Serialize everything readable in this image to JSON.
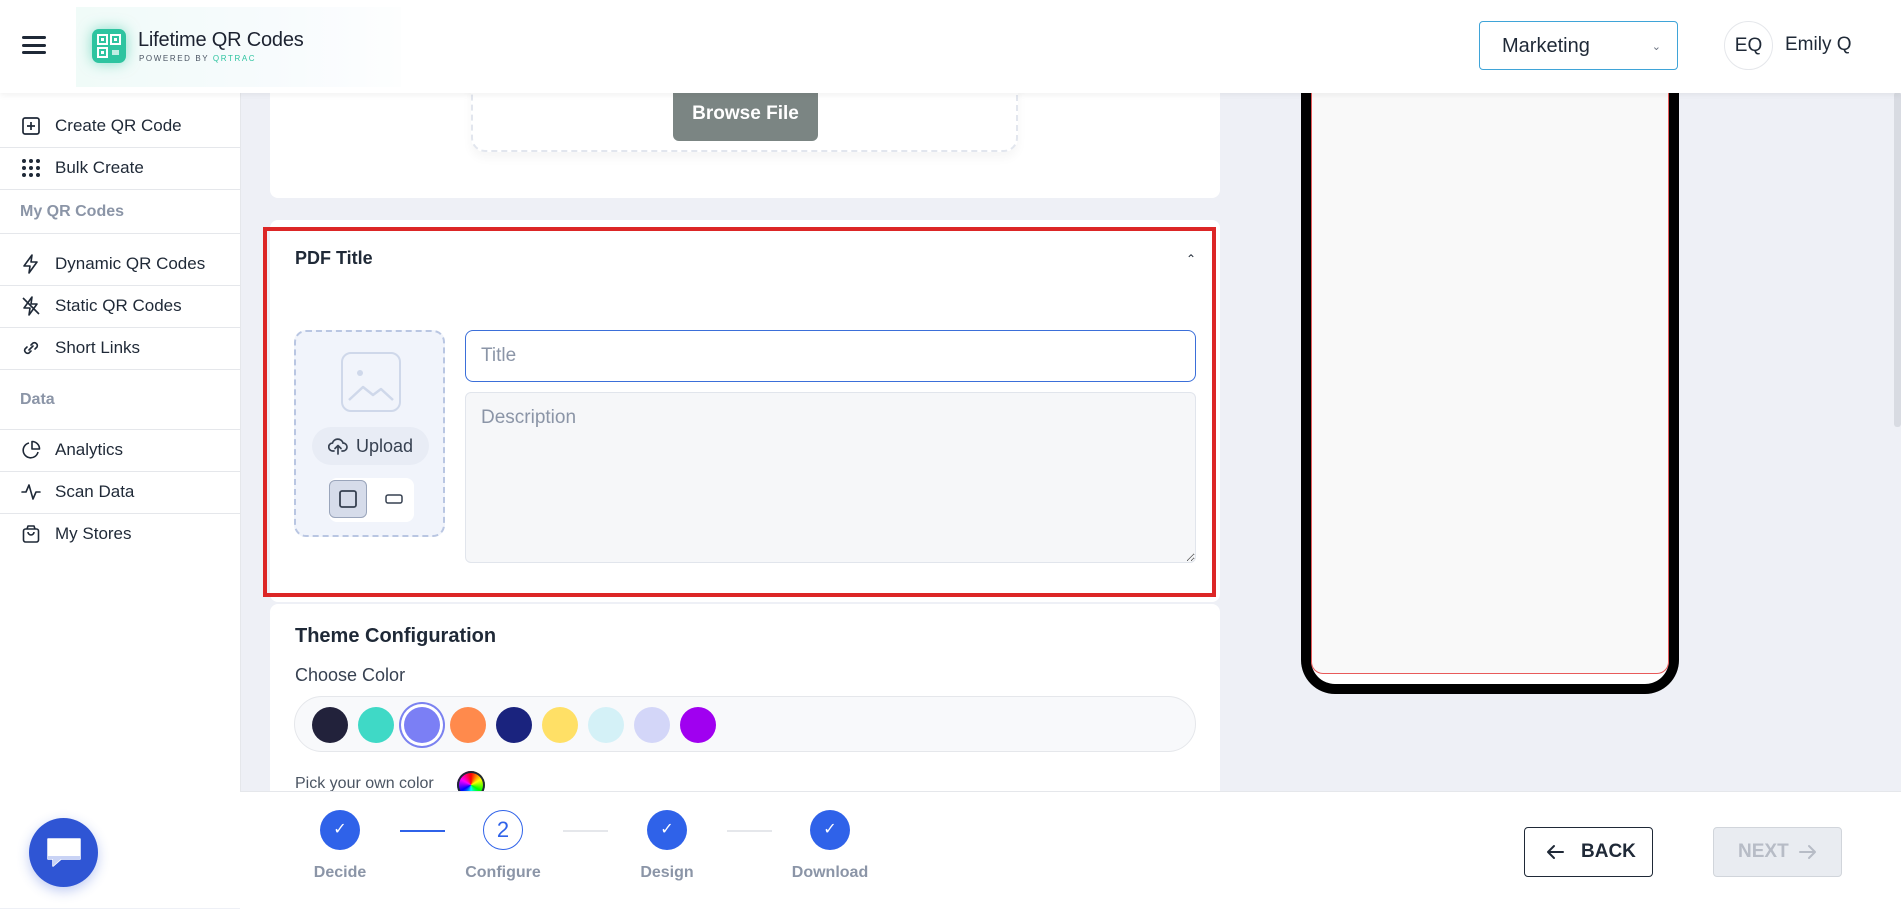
{
  "header": {
    "app_title": "Lifetime QR Codes",
    "app_subtitle_prefix": "POWERED BY ",
    "app_subtitle_brand": "QRTRAC",
    "workspace_select": "Marketing",
    "user_initials": "EQ",
    "user_name": "Emily Q"
  },
  "sidebar": {
    "create_qr": "Create QR Code",
    "bulk_create": "Bulk Create",
    "section_my_qr": "My QR Codes",
    "dynamic_qr": "Dynamic QR Codes",
    "static_qr": "Static QR Codes",
    "short_links": "Short Links",
    "section_data": "Data",
    "analytics": "Analytics",
    "scan_data": "Scan Data",
    "my_stores": "My Stores"
  },
  "upload_panel": {
    "browse_button": "Browse File"
  },
  "pdf_title_section": {
    "heading": "PDF Title",
    "upload_label": "Upload",
    "title_placeholder": "Title",
    "description_placeholder": "Description"
  },
  "theme": {
    "heading": "Theme Configuration",
    "choose_color_label": "Choose Color",
    "pick_own_label": "Pick your own color",
    "colors": [
      "#22223b",
      "#3fd9c6",
      "#7b7ff5",
      "#ff8a4c",
      "#1a237e",
      "#ffe066",
      "#d4f1f7",
      "#d3d6f8",
      "#a000f0"
    ],
    "selected_color": "#7b7ff5"
  },
  "stepper": {
    "steps": [
      {
        "label": "Decide",
        "state": "done"
      },
      {
        "label": "Configure",
        "state": "current",
        "number": "2"
      },
      {
        "label": "Design",
        "state": "done"
      },
      {
        "label": "Download",
        "state": "done"
      }
    ]
  },
  "footer": {
    "back_label": "BACK",
    "next_label": "NEXT"
  },
  "colors": {
    "primary": "#2f62e9",
    "highlight_border": "#dc2626",
    "brand_green": "#2ec4a0"
  }
}
